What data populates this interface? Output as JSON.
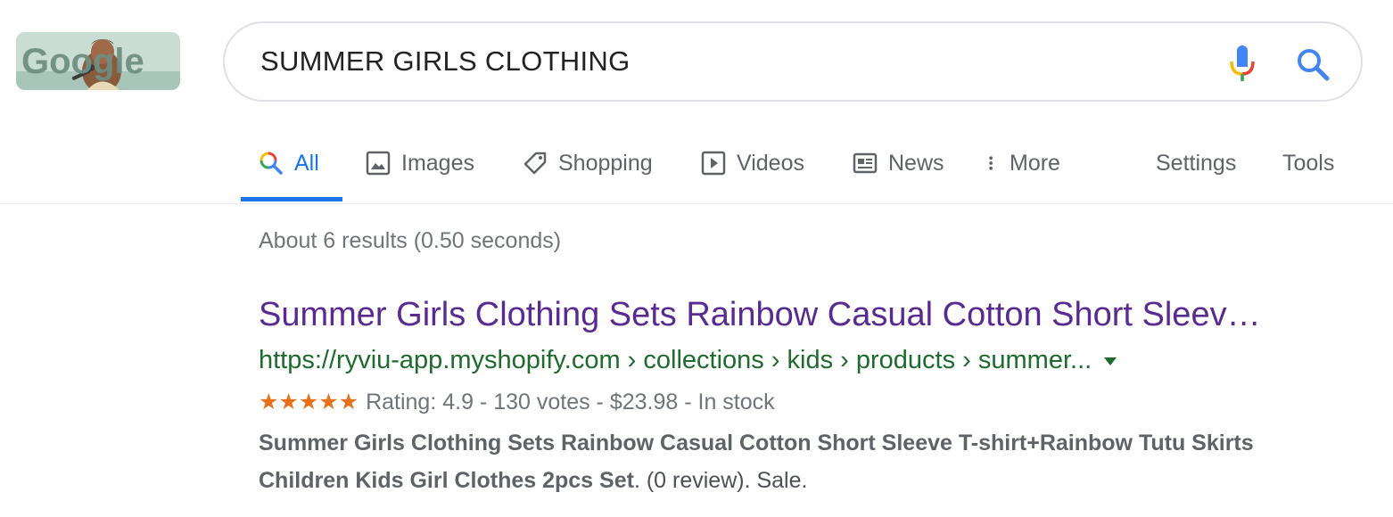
{
  "logo": {
    "text": "Google"
  },
  "search": {
    "query": "SUMMER GIRLS CLOTHING",
    "mic_icon": "mic-icon",
    "search_icon": "search-icon"
  },
  "tabs": [
    {
      "label": "All",
      "icon": "search-icon",
      "active": true
    },
    {
      "label": "Images",
      "icon": "image-icon"
    },
    {
      "label": "Shopping",
      "icon": "tag-icon"
    },
    {
      "label": "Videos",
      "icon": "play-icon"
    },
    {
      "label": "News",
      "icon": "newspaper-icon"
    },
    {
      "label": "More",
      "icon": "more-vertical-icon"
    },
    {
      "label": "Settings"
    },
    {
      "label": "Tools"
    }
  ],
  "results": {
    "stats": "About 6 results (0.50 seconds)",
    "items": [
      {
        "title": "Summer Girls Clothing Sets Rainbow Casual Cotton Short Sleev…",
        "url": "https://ryviu-app.myshopify.com › collections › kids › products › summer...",
        "stars": "★★★★★",
        "rating_text": "Rating: 4.9 - 130 votes - $23.98 - In stock",
        "snippet_bold": "Summer Girls Clothing Sets Rainbow Casual Cotton Short Sleeve T-shirt+Rainbow Tutu Skirts Children Kids Girl Clothes 2pcs Set",
        "snippet_rest": ". (0 review). Sale."
      }
    ]
  },
  "colors": {
    "accent": "#1a73e8",
    "visited_link": "#5a2a93",
    "url_green": "#1e6b2e",
    "star_orange": "#e7711b"
  }
}
